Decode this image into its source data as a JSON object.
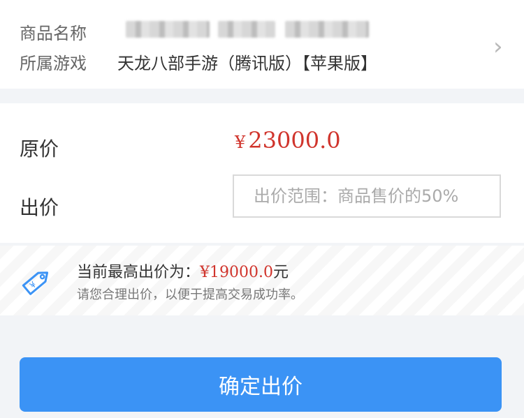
{
  "product": {
    "name_label": "商品名称",
    "game_label": "所属游戏",
    "game_value": "天龙八部手游（腾讯版）【苹果版】",
    "chevron": "›"
  },
  "pricing": {
    "original_label": "原价",
    "currency_symbol": "¥",
    "original_price": "23000.0",
    "bid_label": "出价",
    "bid_placeholder": "出价范围：商品售价的50%"
  },
  "tip": {
    "headline": "当前最高出价为：",
    "highest_bid": "¥19000.0",
    "unit": "元",
    "note": "请您合理出价，以便于提高交易成功率。"
  },
  "action": {
    "confirm_label": "确定出价"
  },
  "colors": {
    "accent": "#3b93f5",
    "price": "#d0342c"
  }
}
